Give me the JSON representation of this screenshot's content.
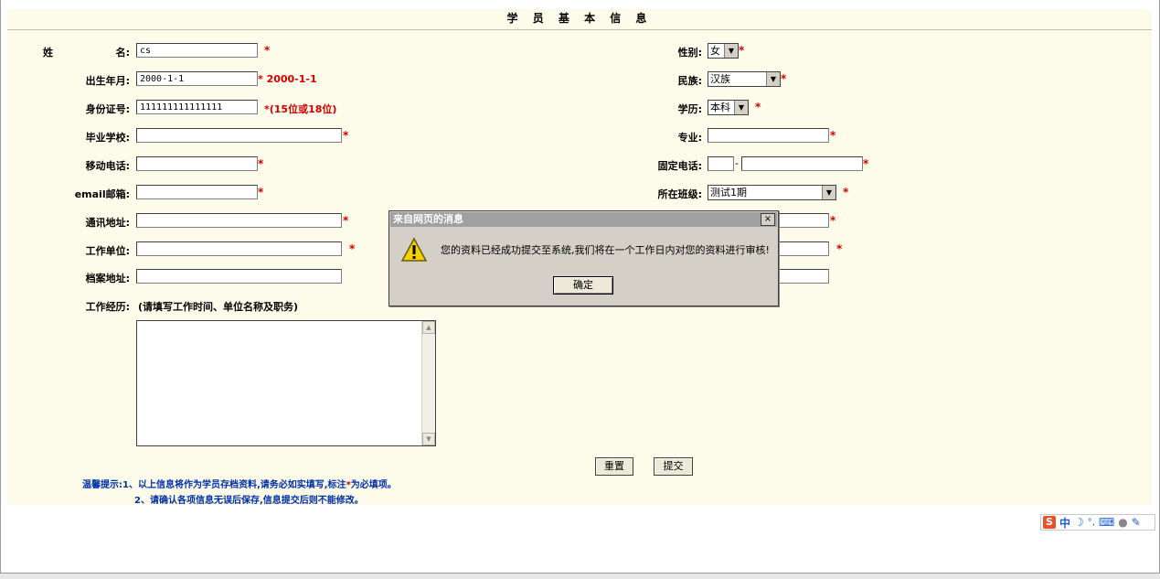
{
  "form": {
    "title": "学 员 基 本 信 息",
    "labels": {
      "name_a": "姓",
      "name_b": "名:",
      "birth": "出生年月:",
      "idno": "身份证号:",
      "school": "毕业学校:",
      "mobile": "移动电话:",
      "email": "email邮箱:",
      "address": "通讯地址:",
      "workplace": "工作单位:",
      "archive": "档案地址:",
      "experience": "工作经历:",
      "experience_hint": "(请填写工作时间、单位名称及职务)",
      "gender": "性别:",
      "nation": "民族:",
      "education": "学历:",
      "major": "专业:",
      "phone": "固定电话:",
      "class": "所在班级:"
    },
    "values": {
      "name": "cs",
      "birth": "2000-1-1",
      "idno": "111111111111111",
      "school": "",
      "mobile": "",
      "email": "",
      "address": "",
      "workplace": "",
      "archive": "",
      "experience": "",
      "gender": "女",
      "nation": "汉族",
      "education": "本科",
      "major": "",
      "phone_area": "",
      "phone_dash": "-",
      "phone_number": "",
      "class": "测试1期"
    },
    "required_mark": "*",
    "birth_hint": "* 2000-1-1",
    "idno_hint": "*(15位或18位)",
    "buttons": {
      "reset": "重置",
      "submit": "提交"
    },
    "tips": {
      "prefix": "温馨提示:",
      "line1_a": "1、以上信息将作为学员存档资料,请务必如实填写,标注",
      "line1_star": "*",
      "line1_b": "为必填项。",
      "line2": "2、请确认各项信息无误后保存,信息提交后则不能修改。"
    }
  },
  "dialog": {
    "title": "来自网页的消息",
    "close": "×",
    "message": "您的资料已经成功提交至系统,我们将在一个工作日内对您的资料进行审核!",
    "ok_label": "确定"
  },
  "ime": {
    "logo": "S",
    "mode": "中"
  },
  "colors": {
    "panel_bg": "#fdfbe9",
    "required_red": "#d00000",
    "tips_blue": "#0030a8",
    "dialog_bg": "#d4d0c8"
  }
}
